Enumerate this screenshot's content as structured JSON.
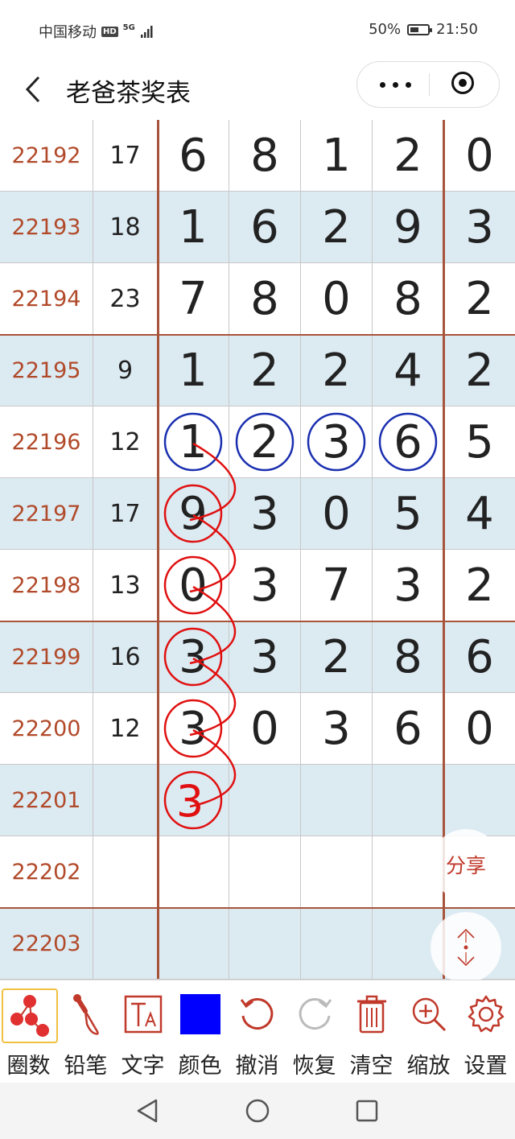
{
  "status": {
    "carrier": "中国移动",
    "hd": "HD",
    "signal": "5G",
    "battery": "50%",
    "battery_level": 0.5,
    "time": "21:50"
  },
  "header": {
    "title": "老爸茶奖表"
  },
  "table": {
    "rows": [
      {
        "period": "22192",
        "sum": "17",
        "digits": [
          "6",
          "8",
          "1",
          "2",
          "0"
        ]
      },
      {
        "period": "22193",
        "sum": "18",
        "digits": [
          "1",
          "6",
          "2",
          "9",
          "3"
        ]
      },
      {
        "period": "22194",
        "sum": "23",
        "digits": [
          "7",
          "8",
          "0",
          "8",
          "2"
        ]
      },
      {
        "period": "22195",
        "sum": "9",
        "digits": [
          "1",
          "2",
          "2",
          "4",
          "2"
        ]
      },
      {
        "period": "22196",
        "sum": "12",
        "digits": [
          "1",
          "2",
          "3",
          "6",
          "5"
        ]
      },
      {
        "period": "22197",
        "sum": "17",
        "digits": [
          "9",
          "3",
          "0",
          "5",
          "4"
        ]
      },
      {
        "period": "22198",
        "sum": "13",
        "digits": [
          "0",
          "3",
          "7",
          "3",
          "2"
        ]
      },
      {
        "period": "22199",
        "sum": "16",
        "digits": [
          "3",
          "3",
          "2",
          "8",
          "6"
        ]
      },
      {
        "period": "22200",
        "sum": "12",
        "digits": [
          "3",
          "0",
          "3",
          "6",
          "0"
        ]
      },
      {
        "period": "22201",
        "sum": "",
        "digits": [
          "",
          "",
          "",
          "",
          ""
        ]
      },
      {
        "period": "22202",
        "sum": "",
        "digits": [
          "",
          "",
          "",
          "",
          ""
        ]
      },
      {
        "period": "22203",
        "sum": "",
        "digits": [
          "",
          "",
          "",
          "",
          ""
        ]
      }
    ],
    "prediction": "3"
  },
  "colors": {
    "period_text": "#b14a2a",
    "separator": "#a8543b",
    "stripe": "#dceaf2",
    "circle_blue": "#1a2fb0",
    "circle_red": "#e01010",
    "selected_color": "#0000ff"
  },
  "float": {
    "share": "分享"
  },
  "toolbar": [
    {
      "label": "圈数",
      "icon": "circle-numbers-icon"
    },
    {
      "label": "铅笔",
      "icon": "brush-icon"
    },
    {
      "label": "文字",
      "icon": "text-icon"
    },
    {
      "label": "颜色",
      "icon": "color-swatch-icon"
    },
    {
      "label": "撤消",
      "icon": "undo-icon"
    },
    {
      "label": "恢复",
      "icon": "redo-icon"
    },
    {
      "label": "清空",
      "icon": "trash-icon"
    },
    {
      "label": "缩放",
      "icon": "zoom-in-icon"
    },
    {
      "label": "设置",
      "icon": "gear-icon"
    }
  ]
}
